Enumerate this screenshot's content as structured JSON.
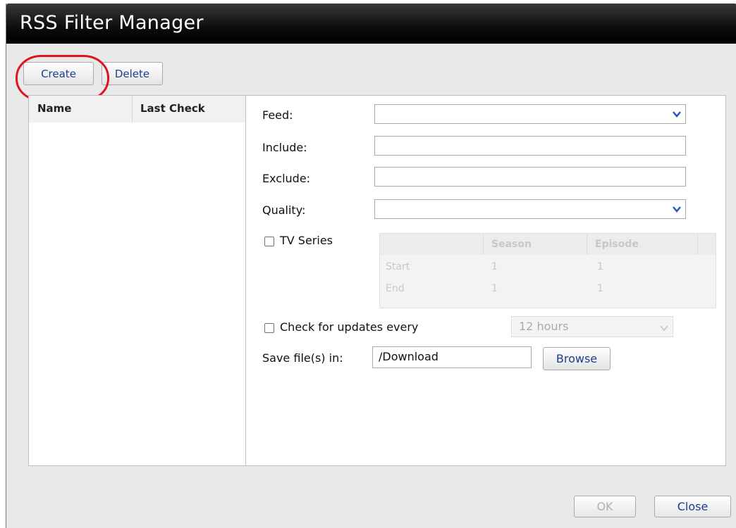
{
  "window": {
    "title": "RSS Filter Manager"
  },
  "toolbar": {
    "create_label": "Create",
    "delete_label": "Delete"
  },
  "filter_list": {
    "columns": [
      "Name",
      "Last Check"
    ],
    "rows": []
  },
  "form": {
    "feed_label": "Feed:",
    "feed_value": "",
    "include_label": "Include:",
    "include_value": "",
    "exclude_label": "Exclude:",
    "exclude_value": "",
    "quality_label": "Quality:",
    "quality_value": "",
    "tv_series_label": "TV Series",
    "tv_series_checked": false,
    "tv_grid": {
      "headers": [
        "Season",
        "Episode"
      ],
      "rows": [
        {
          "label": "Start",
          "season": "1",
          "episode": "1"
        },
        {
          "label": "End",
          "season": "1",
          "episode": "1"
        }
      ]
    },
    "check_updates_label": "Check for updates every",
    "check_updates_checked": false,
    "interval_value": "12 hours",
    "save_label": "Save file(s) in:",
    "save_path": "/Download",
    "browse_label": "Browse"
  },
  "footer": {
    "ok_label": "OK",
    "close_label": "Close"
  },
  "colors": {
    "link_blue": "#1b3f8f",
    "highlight_red": "#e0141c",
    "arrow_blue": "#2b57b8"
  },
  "icons": [
    "chevron-down-icon"
  ]
}
